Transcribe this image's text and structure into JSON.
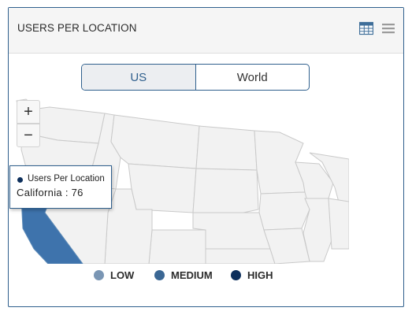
{
  "panel": {
    "title": "USERS PER LOCATION"
  },
  "header_icons": {
    "table": "table-icon",
    "menu": "hamburger-menu-icon"
  },
  "toggle": {
    "options": [
      "US",
      "World"
    ],
    "selected": "US"
  },
  "zoom": {
    "in_label": "+",
    "out_label": "−"
  },
  "tooltip": {
    "series": "Users Per Location",
    "text": "California : 76",
    "state": "California",
    "value": 76
  },
  "legend": [
    {
      "label": "LOW",
      "color": "#7a96b4"
    },
    {
      "label": "MEDIUM",
      "color": "#3b6794"
    },
    {
      "label": "HIGH",
      "color": "#0d2f5c"
    }
  ],
  "colors": {
    "accent": "#2f5f8d",
    "state_fill": "#f2f2f2",
    "state_stroke": "#c9c9c9",
    "california": "#3e73ac"
  }
}
